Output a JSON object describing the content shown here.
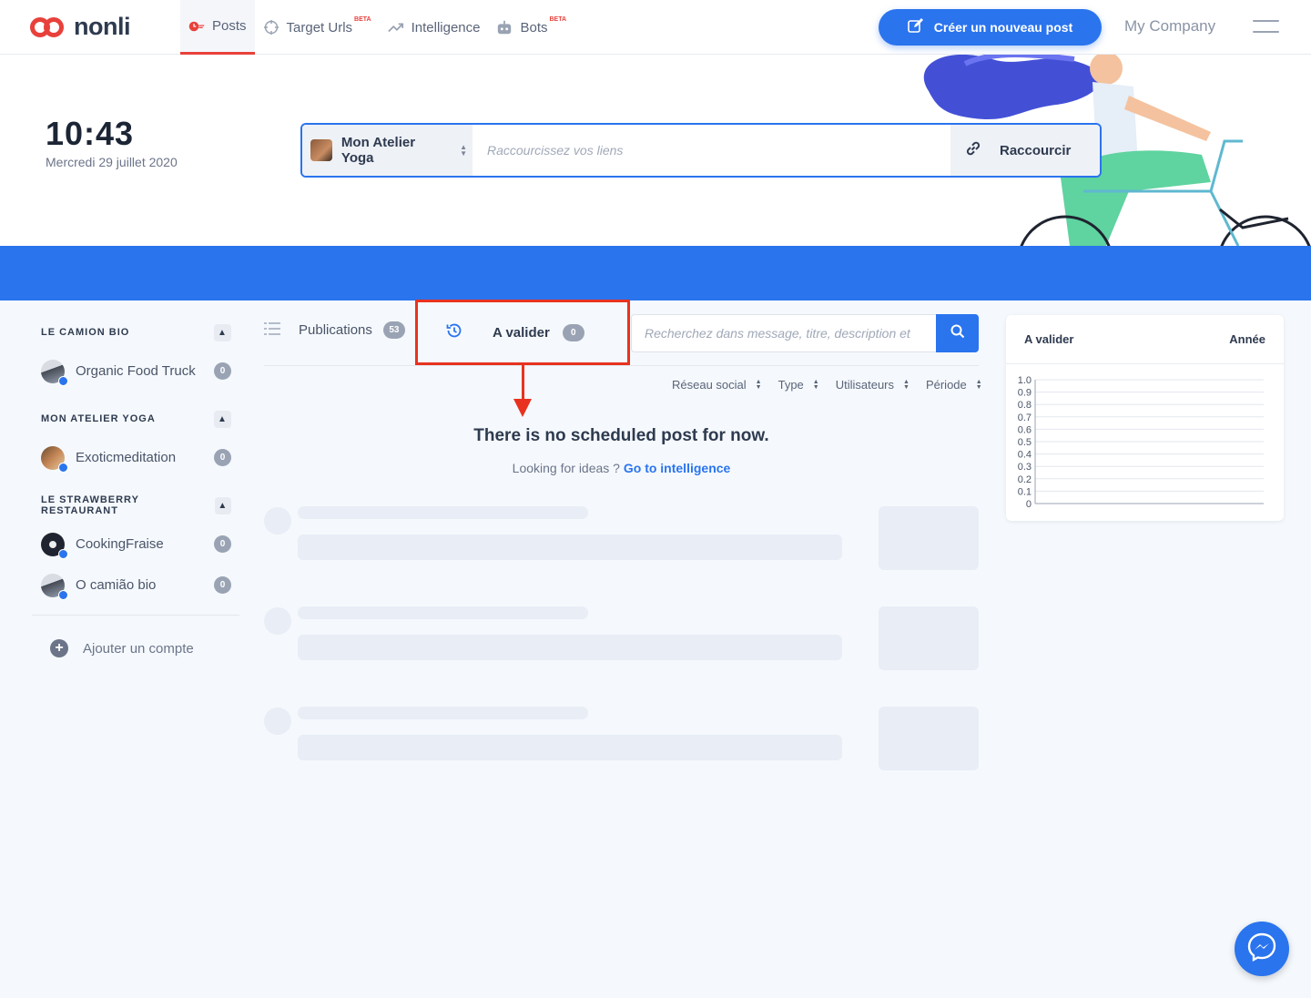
{
  "brand": {
    "name": "nonli"
  },
  "nav": [
    {
      "label": "Posts",
      "beta": "",
      "icon": "posts-icon",
      "active": true
    },
    {
      "label": "Target Urls",
      "beta": "BETA",
      "icon": "target-icon"
    },
    {
      "label": "Intelligence",
      "beta": "",
      "icon": "trend-icon"
    },
    {
      "label": "Bots",
      "beta": "BETA",
      "icon": "bot-icon"
    }
  ],
  "header": {
    "create_label": "Créer un nouveau post",
    "company": "My Company"
  },
  "clock": {
    "time": "10:43",
    "date": "Mercredi 29 juillet 2020"
  },
  "shortener": {
    "account": "Mon Atelier Yoga",
    "placeholder": "Raccourcissez vos liens",
    "button": "Raccourcir"
  },
  "sidebar": {
    "groups": [
      {
        "title": "LE CAMION BIO",
        "accounts": [
          {
            "name": "Organic Food Truck",
            "count": "0"
          }
        ]
      },
      {
        "title": "MON ATELIER YOGA",
        "accounts": [
          {
            "name": "Exoticmeditation",
            "count": "0"
          }
        ]
      },
      {
        "title": "LE STRAWBERRY RESTAURANT",
        "accounts": [
          {
            "name": "CookingFraise",
            "count": "0"
          },
          {
            "name": "O camião bio",
            "count": "0"
          }
        ]
      }
    ],
    "add_label": "Ajouter un compte"
  },
  "tabs": {
    "publications": {
      "label": "Publications",
      "count": "53"
    },
    "validate": {
      "label": "A valider",
      "count": "0"
    }
  },
  "search": {
    "placeholder": "Recherchez dans message, titre, description et"
  },
  "filters": [
    "Réseau social",
    "Type",
    "Utilisateurs",
    "Période"
  ],
  "empty": {
    "title": "There is no scheduled post for now.",
    "sub": "Looking for ideas ?",
    "link": "Go to intelligence"
  },
  "widget": {
    "title": "A valider",
    "period": "Année",
    "y_ticks": [
      "1.0",
      "0.9",
      "0.8",
      "0.7",
      "0.6",
      "0.5",
      "0.4",
      "0.3",
      "0.2",
      "0.1",
      "0"
    ]
  },
  "colors": {
    "accent": "#2a74ee",
    "brand": "#e8413b",
    "highlight": "#e8321f"
  }
}
